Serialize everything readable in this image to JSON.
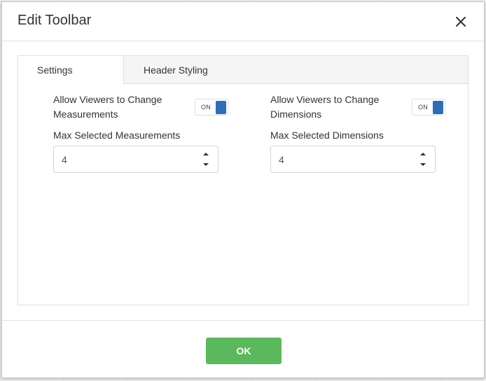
{
  "dialog": {
    "title": "Edit Toolbar"
  },
  "tabs": [
    {
      "label": "Settings",
      "active": true
    },
    {
      "label": "Header Styling",
      "active": false
    }
  ],
  "left": {
    "toggle_label": "Allow Viewers to Change Measurements",
    "toggle_state": "ON",
    "field_label": "Max Selected Measurements",
    "value": "4"
  },
  "right": {
    "toggle_label": "Allow Viewers to Change Dimensions",
    "toggle_state": "ON",
    "field_label": "Max Selected Dimensions",
    "value": "4"
  },
  "footer": {
    "ok_label": "OK"
  },
  "colors": {
    "ok_button": "#5cb85c",
    "toggle_knob": "#2f6db5"
  },
  "icons": {
    "close": "close-icon",
    "spin_up": "caret-up-icon",
    "spin_down": "caret-down-icon"
  }
}
